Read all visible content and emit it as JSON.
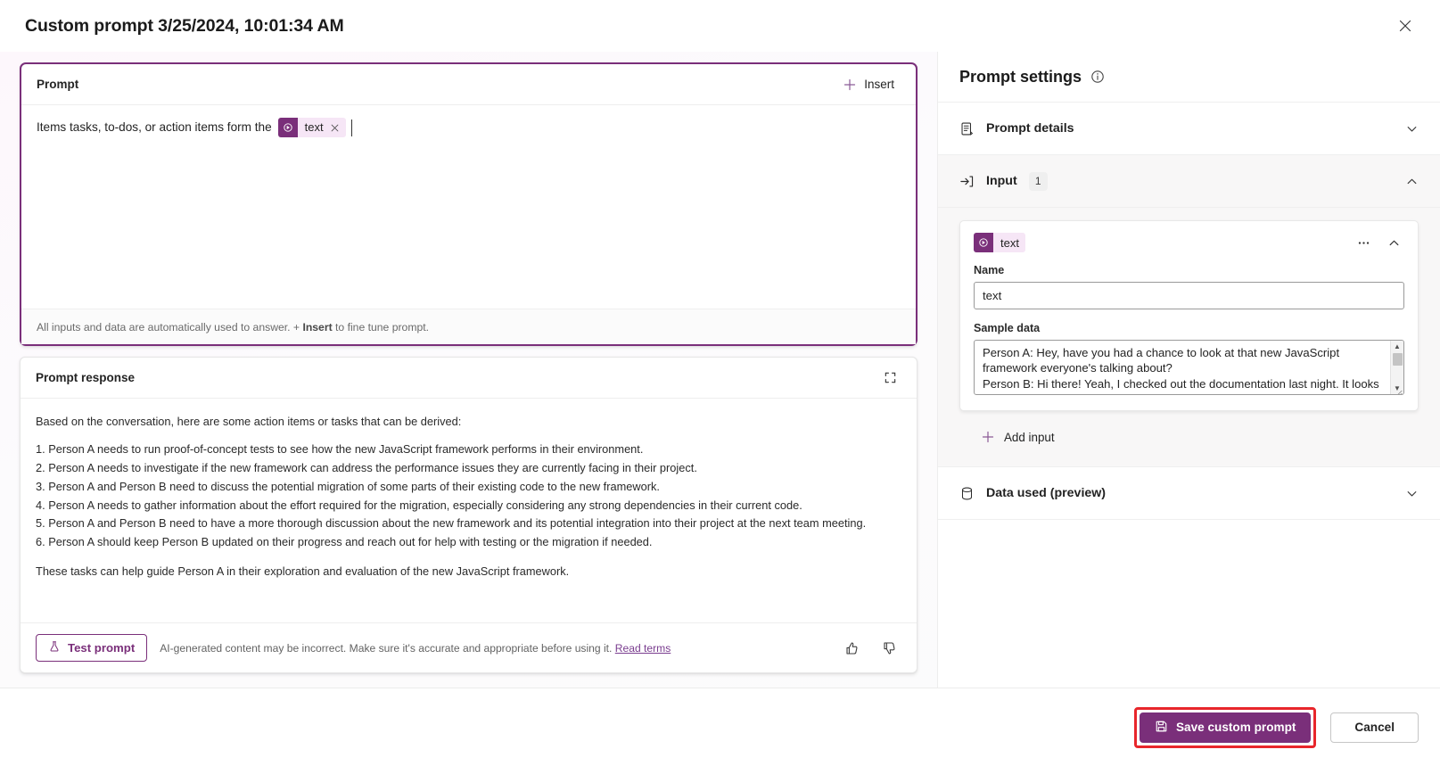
{
  "window": {
    "title": "Custom prompt 3/25/2024, 10:01:34 AM",
    "close_icon": "close-icon"
  },
  "prompt_card": {
    "title": "Prompt",
    "insert_label": "Insert",
    "text_before_token": "Items tasks, to-dos, or action items form the",
    "token_label": "text",
    "footer_prefix": "All inputs and data are automatically used to answer. +",
    "footer_bold": "Insert",
    "footer_suffix": "to fine tune prompt."
  },
  "response_card": {
    "title": "Prompt response",
    "expand_icon": "expand-icon",
    "intro": "Based on the conversation, here are some action items or tasks that can be derived:",
    "items": [
      "1. Person A needs to run proof-of-concept tests to see how the new JavaScript framework performs in their environment.",
      "2. Person A needs to investigate if the new framework can address the performance issues they are currently facing in their project.",
      "3. Person A and Person B need to discuss the potential migration of some parts of their existing code to the new framework.",
      "4. Person A needs to gather information about the effort required for the migration, especially considering any strong dependencies in their current code.",
      "5. Person A and Person B need to have a more thorough discussion about the new framework and its potential integration into their project at the next team meeting.",
      "6. Person A should keep Person B updated on their progress and reach out for help with testing or the migration if needed."
    ],
    "outro": "These tasks can help guide Person A in their exploration and evaluation of the new JavaScript framework.",
    "test_button": "Test prompt",
    "disclaimer": "AI-generated content may be incorrect. Make sure it's accurate and appropriate before using it.",
    "terms_link": "Read terms",
    "thumbs_up_icon": "thumbs-up-icon",
    "thumbs_down_icon": "thumbs-down-icon"
  },
  "settings": {
    "title": "Prompt settings",
    "info_icon": "info-icon",
    "prompt_details_label": "Prompt details",
    "input_label": "Input",
    "input_count": "1",
    "input_card": {
      "token_label": "text",
      "more_icon": "ellipsis-icon",
      "name_label": "Name",
      "name_value": "text",
      "sample_label": "Sample data",
      "sample_value": "Person A: Hey, have you had a chance to look at that new JavaScript framework everyone's talking about?\nPerson B: Hi there! Yeah, I checked out the documentation last night. It looks promising. Performance seems solid but there's a"
    },
    "add_input_label": "Add input",
    "data_used_label": "Data used (preview)"
  },
  "footer": {
    "save_label": "Save custom prompt",
    "cancel_label": "Cancel",
    "save_icon": "save-icon",
    "highlight_color": "#e8262b",
    "accent_color": "#7a2f7a"
  }
}
